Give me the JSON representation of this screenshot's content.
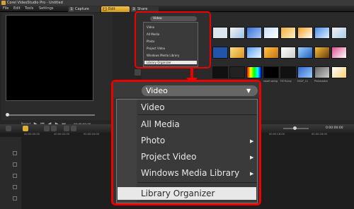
{
  "window": {
    "title": "Corel VideoStudio Pro - Untitled"
  },
  "menu": {
    "items": [
      "File",
      "Edit",
      "Tools",
      "Settings"
    ]
  },
  "steps": [
    {
      "num": "1",
      "label": "Capture"
    },
    {
      "num": "2",
      "label": "Edit"
    },
    {
      "num": "3",
      "label": "Share"
    }
  ],
  "preview": {
    "project_label": "Project",
    "clip_label": "Clip",
    "timecode": "00:00:00:00"
  },
  "library": {
    "thumb_captions": [
      "Book.jpg",
      "Butterflyan",
      "SP-V01.wmv",
      "SP-V02.mp4",
      "small swing",
      "Fill Funny",
      "DSCF_11",
      "Pinkmaster"
    ]
  },
  "mini_dropdown": {
    "selected": "Video",
    "items": [
      "Video",
      "All Media",
      "Photo",
      "Project Video",
      "Windows Media Library",
      "Library Organizer"
    ]
  },
  "big_dropdown": {
    "selected": "Video",
    "items": [
      {
        "label": "Video",
        "submenu": false
      },
      {
        "label": "All Media",
        "submenu": false
      },
      {
        "label": "Photo",
        "submenu": true
      },
      {
        "label": "Project Video",
        "submenu": true
      },
      {
        "label": "Windows Media Library",
        "submenu": true
      },
      {
        "label": "Library Organizer",
        "submenu": false
      }
    ]
  },
  "timeline": {
    "ruler": [
      "00:00:00:00",
      "00:00:02:00",
      "00:00:04:00",
      "00:00:06:00",
      "00:00:08:00",
      "00:00:10:00",
      "00:00:12:00",
      "00:00:14:00",
      "00:00:16:00",
      "00:00:18:00"
    ],
    "timecode": "0:00:00:00"
  },
  "colors": {
    "accent": "#e0b030",
    "annotation": "#ee0000"
  }
}
